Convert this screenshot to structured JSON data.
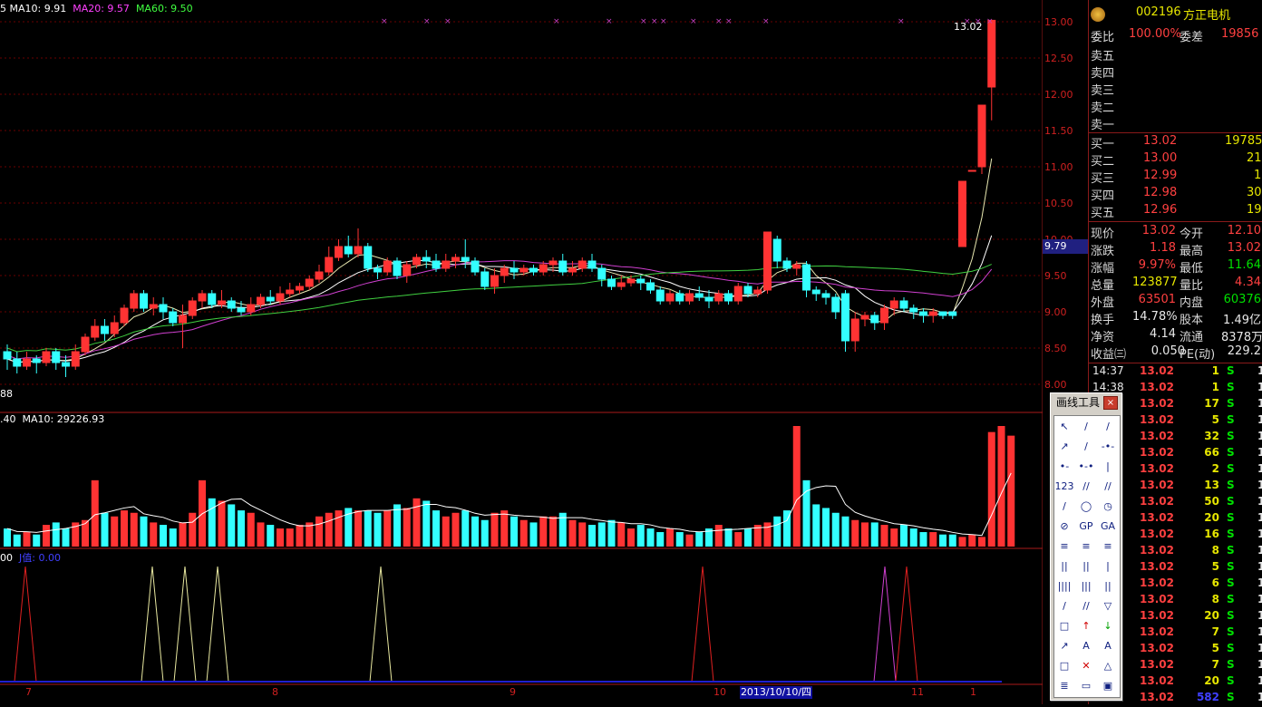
{
  "stock": {
    "code": "002196",
    "name": "方正电机"
  },
  "legend": {
    "ma_line": [
      {
        "label": "MA10: 9.91",
        "color": "#ffffff"
      },
      {
        "label": "MA20: 9.57",
        "color": "#ff40ff"
      },
      {
        "label": "MA60: 9.50",
        "color": "#40ff40"
      }
    ],
    "volume": [
      {
        "label": ".40",
        "color": "#ffffff"
      },
      {
        "label": "MA10: 29226.93",
        "color": "#ffffff"
      }
    ],
    "indicator": [
      {
        "label": "00",
        "color": "#ffffff"
      },
      {
        "label": "J值: 0.00",
        "color": "#4040ff"
      }
    ]
  },
  "price_axis": [
    "13.00",
    "12.50",
    "12.00",
    "11.50",
    "11.00",
    "10.50",
    "10.00",
    "9.50",
    "9.00",
    "8.50",
    "8.00"
  ],
  "price_marker": "9.79",
  "high_label": "13.02",
  "low_label": "88",
  "x_labels": [
    "7",
    "8",
    "9",
    "10",
    "11",
    "1"
  ],
  "date_cursor": "2013/10/10/四",
  "quote": {
    "weibi_label": "委比",
    "weibi": "100.00%",
    "weicha_label": "委差",
    "weicha": "19856",
    "sell": [
      {
        "label": "卖五",
        "price": "",
        "vol": ""
      },
      {
        "label": "卖四",
        "price": "",
        "vol": ""
      },
      {
        "label": "卖三",
        "price": "",
        "vol": ""
      },
      {
        "label": "卖二",
        "price": "",
        "vol": ""
      },
      {
        "label": "卖一",
        "price": "",
        "vol": ""
      }
    ],
    "buy": [
      {
        "label": "买一",
        "price": "13.02",
        "vol": "19785"
      },
      {
        "label": "买二",
        "price": "13.00",
        "vol": "21"
      },
      {
        "label": "买三",
        "price": "12.99",
        "vol": "1"
      },
      {
        "label": "买四",
        "price": "12.98",
        "vol": "30"
      },
      {
        "label": "买五",
        "price": "12.96",
        "vol": "19"
      }
    ],
    "stats": [
      {
        "l1": "现价",
        "v1": "13.02",
        "c1": "red",
        "l2": "今开",
        "v2": "12.10",
        "c2": "red"
      },
      {
        "l1": "涨跌",
        "v1": "1.18",
        "c1": "red",
        "l2": "最高",
        "v2": "13.02",
        "c2": "red"
      },
      {
        "l1": "涨幅",
        "v1": "9.97%",
        "c1": "red",
        "l2": "最低",
        "v2": "11.64",
        "c2": "grn"
      },
      {
        "l1": "总量",
        "v1": "123877",
        "c1": "yel",
        "l2": "量比",
        "v2": "4.34",
        "c2": "red"
      },
      {
        "l1": "外盘",
        "v1": "63501",
        "c1": "red",
        "l2": "内盘",
        "v2": "60376",
        "c2": "grn"
      },
      {
        "l1": "换手",
        "v1": "14.78%",
        "c1": "wht",
        "l2": "股本",
        "v2": "1.49亿",
        "c2": "wht"
      },
      {
        "l1": "净资",
        "v1": "4.14",
        "c1": "wht",
        "l2": "流通",
        "v2": "8378万",
        "c2": "wht"
      },
      {
        "l1": "收益㈢",
        "v1": "0.050",
        "c1": "wht",
        "l2": "PE(动)",
        "v2": "229.2",
        "c2": "wht"
      }
    ],
    "ticks": [
      {
        "time": "14:37",
        "price": "13.02",
        "vol": "1",
        "bs": "S",
        "n": "1"
      },
      {
        "time": "14:38",
        "price": "13.02",
        "vol": "1",
        "bs": "S",
        "n": "1"
      },
      {
        "time": "",
        "price": "13.02",
        "vol": "17",
        "bs": "S",
        "n": "1"
      },
      {
        "time": "",
        "price": "13.02",
        "vol": "5",
        "bs": "S",
        "n": "1"
      },
      {
        "time": "",
        "price": "13.02",
        "vol": "32",
        "bs": "S",
        "n": "1"
      },
      {
        "time": "",
        "price": "13.02",
        "vol": "66",
        "bs": "S",
        "n": "1"
      },
      {
        "time": "",
        "price": "13.02",
        "vol": "2",
        "bs": "S",
        "n": "1"
      },
      {
        "time": "",
        "price": "13.02",
        "vol": "13",
        "bs": "S",
        "n": "1"
      },
      {
        "time": "",
        "price": "13.02",
        "vol": "50",
        "bs": "S",
        "n": "1"
      },
      {
        "time": "",
        "price": "13.02",
        "vol": "20",
        "bs": "S",
        "n": "1"
      },
      {
        "time": "",
        "price": "13.02",
        "vol": "16",
        "bs": "S",
        "n": "1"
      },
      {
        "time": "",
        "price": "13.02",
        "vol": "8",
        "bs": "S",
        "n": "1"
      },
      {
        "time": "",
        "price": "13.02",
        "vol": "5",
        "bs": "S",
        "n": "1"
      },
      {
        "time": "",
        "price": "13.02",
        "vol": "6",
        "bs": "S",
        "n": "1"
      },
      {
        "time": "",
        "price": "13.02",
        "vol": "8",
        "bs": "S",
        "n": "1"
      },
      {
        "time": "",
        "price": "13.02",
        "vol": "20",
        "bs": "S",
        "n": "1"
      },
      {
        "time": "",
        "price": "13.02",
        "vol": "7",
        "bs": "S",
        "n": "1"
      },
      {
        "time": "",
        "price": "13.02",
        "vol": "5",
        "bs": "S",
        "n": "1"
      },
      {
        "time": "",
        "price": "13.02",
        "vol": "7",
        "bs": "S",
        "n": "1"
      },
      {
        "time": "",
        "price": "13.02",
        "vol": "20",
        "bs": "S",
        "n": "1"
      },
      {
        "time": "",
        "price": "13.02",
        "vol": "582",
        "bs": "S",
        "n": "1"
      }
    ]
  },
  "toolbar": {
    "title": "画线工具",
    "close": "×",
    "tools": [
      "↖",
      "/",
      "/",
      "↗",
      "/",
      "-•-",
      "•-",
      "•-•",
      "|",
      "123",
      "//",
      "//",
      "/",
      "◯",
      "◷",
      "⊘",
      "GP",
      "GA",
      "≡",
      "≡",
      "≡",
      "||",
      "||",
      "|",
      "||||",
      "|||",
      "||",
      "/",
      "//",
      "▽",
      "□",
      "↑",
      "↓",
      "↗",
      "A",
      "A",
      "□",
      "✕",
      "△",
      "≣",
      "▭",
      "▣"
    ]
  },
  "chart_data": {
    "type": "line",
    "candles": [
      {
        "o": 8.45,
        "c": 8.35,
        "h": 8.55,
        "l": 8.2
      },
      {
        "o": 8.35,
        "c": 8.25,
        "h": 8.45,
        "l": 8.15
      },
      {
        "o": 8.25,
        "c": 8.35,
        "h": 8.45,
        "l": 8.2
      },
      {
        "o": 8.35,
        "c": 8.3,
        "h": 8.4,
        "l": 8.15
      },
      {
        "o": 8.3,
        "c": 8.45,
        "h": 8.5,
        "l": 8.25
      },
      {
        "o": 8.45,
        "c": 8.3,
        "h": 8.5,
        "l": 8.2
      },
      {
        "o": 8.3,
        "c": 8.25,
        "h": 8.4,
        "l": 8.1
      },
      {
        "o": 8.25,
        "c": 8.45,
        "h": 8.55,
        "l": 8.2
      },
      {
        "o": 8.45,
        "c": 8.65,
        "h": 8.7,
        "l": 8.4
      },
      {
        "o": 8.65,
        "c": 8.8,
        "h": 8.9,
        "l": 8.6
      },
      {
        "o": 8.8,
        "c": 8.7,
        "h": 8.9,
        "l": 8.6
      },
      {
        "o": 8.7,
        "c": 8.85,
        "h": 8.95,
        "l": 8.65
      },
      {
        "o": 8.85,
        "c": 9.05,
        "h": 9.1,
        "l": 8.8
      },
      {
        "o": 9.05,
        "c": 9.25,
        "h": 9.3,
        "l": 9.0
      },
      {
        "o": 9.25,
        "c": 9.05,
        "h": 9.3,
        "l": 9.0
      },
      {
        "o": 9.05,
        "c": 9.1,
        "h": 9.2,
        "l": 8.95
      },
      {
        "o": 9.1,
        "c": 9.0,
        "h": 9.2,
        "l": 8.9
      },
      {
        "o": 9.0,
        "c": 8.85,
        "h": 9.05,
        "l": 8.8
      },
      {
        "o": 8.85,
        "c": 8.95,
        "h": 9.1,
        "l": 8.5
      },
      {
        "o": 8.95,
        "c": 9.15,
        "h": 9.2,
        "l": 8.9
      },
      {
        "o": 9.15,
        "c": 9.25,
        "h": 9.3,
        "l": 9.05
      },
      {
        "o": 9.25,
        "c": 9.1,
        "h": 9.3,
        "l": 9.05
      },
      {
        "o": 9.1,
        "c": 9.15,
        "h": 9.3,
        "l": 9.05
      },
      {
        "o": 9.15,
        "c": 9.05,
        "h": 9.2,
        "l": 9.0
      },
      {
        "o": 9.05,
        "c": 9.0,
        "h": 9.15,
        "l": 8.95
      },
      {
        "o": 9.0,
        "c": 9.1,
        "h": 9.2,
        "l": 8.95
      },
      {
        "o": 9.1,
        "c": 9.2,
        "h": 9.25,
        "l": 9.05
      },
      {
        "o": 9.2,
        "c": 9.15,
        "h": 9.3,
        "l": 9.1
      },
      {
        "o": 9.15,
        "c": 9.25,
        "h": 9.35,
        "l": 9.1
      },
      {
        "o": 9.25,
        "c": 9.3,
        "h": 9.4,
        "l": 9.2
      },
      {
        "o": 9.3,
        "c": 9.35,
        "h": 9.4,
        "l": 9.25
      },
      {
        "o": 9.35,
        "c": 9.45,
        "h": 9.5,
        "l": 9.3
      },
      {
        "o": 9.45,
        "c": 9.55,
        "h": 9.65,
        "l": 9.4
      },
      {
        "o": 9.55,
        "c": 9.75,
        "h": 9.9,
        "l": 9.5
      },
      {
        "o": 9.75,
        "c": 9.9,
        "h": 10.0,
        "l": 9.7
      },
      {
        "o": 9.9,
        "c": 9.8,
        "h": 10.05,
        "l": 9.75
      },
      {
        "o": 9.8,
        "c": 9.9,
        "h": 10.15,
        "l": 9.75
      },
      {
        "o": 9.9,
        "c": 9.6,
        "h": 9.95,
        "l": 9.55
      },
      {
        "o": 9.6,
        "c": 9.55,
        "h": 9.65,
        "l": 9.45
      },
      {
        "o": 9.55,
        "c": 9.7,
        "h": 9.75,
        "l": 9.5
      },
      {
        "o": 9.7,
        "c": 9.5,
        "h": 9.75,
        "l": 9.45
      },
      {
        "o": 9.5,
        "c": 9.65,
        "h": 9.7,
        "l": 9.4
      },
      {
        "o": 9.65,
        "c": 9.75,
        "h": 9.8,
        "l": 9.6
      },
      {
        "o": 9.75,
        "c": 9.7,
        "h": 9.85,
        "l": 9.6
      },
      {
        "o": 9.7,
        "c": 9.6,
        "h": 9.8,
        "l": 9.55
      },
      {
        "o": 9.6,
        "c": 9.7,
        "h": 9.8,
        "l": 9.55
      },
      {
        "o": 9.7,
        "c": 9.75,
        "h": 9.8,
        "l": 9.6
      },
      {
        "o": 9.75,
        "c": 9.7,
        "h": 10.0,
        "l": 9.6
      },
      {
        "o": 9.7,
        "c": 9.55,
        "h": 9.75,
        "l": 9.5
      },
      {
        "o": 9.55,
        "c": 9.35,
        "h": 9.6,
        "l": 9.3
      },
      {
        "o": 9.35,
        "c": 9.5,
        "h": 9.6,
        "l": 9.25
      },
      {
        "o": 9.5,
        "c": 9.6,
        "h": 9.65,
        "l": 9.4
      },
      {
        "o": 9.6,
        "c": 9.55,
        "h": 9.7,
        "l": 9.45
      },
      {
        "o": 9.55,
        "c": 9.6,
        "h": 9.65,
        "l": 9.5
      },
      {
        "o": 9.6,
        "c": 9.55,
        "h": 9.65,
        "l": 9.5
      },
      {
        "o": 9.55,
        "c": 9.65,
        "h": 9.7,
        "l": 9.5
      },
      {
        "o": 9.65,
        "c": 9.7,
        "h": 9.75,
        "l": 9.55
      },
      {
        "o": 9.7,
        "c": 9.55,
        "h": 9.8,
        "l": 9.5
      },
      {
        "o": 9.55,
        "c": 9.6,
        "h": 9.7,
        "l": 9.5
      },
      {
        "o": 9.6,
        "c": 9.7,
        "h": 9.75,
        "l": 9.55
      },
      {
        "o": 9.7,
        "c": 9.6,
        "h": 9.8,
        "l": 9.55
      },
      {
        "o": 9.6,
        "c": 9.45,
        "h": 9.65,
        "l": 9.35
      },
      {
        "o": 9.45,
        "c": 9.35,
        "h": 9.5,
        "l": 9.3
      },
      {
        "o": 9.35,
        "c": 9.4,
        "h": 9.5,
        "l": 9.3
      },
      {
        "o": 9.4,
        "c": 9.45,
        "h": 9.5,
        "l": 9.35
      },
      {
        "o": 9.45,
        "c": 9.4,
        "h": 9.5,
        "l": 9.3
      },
      {
        "o": 9.4,
        "c": 9.3,
        "h": 9.45,
        "l": 9.25
      },
      {
        "o": 9.3,
        "c": 9.15,
        "h": 9.35,
        "l": 9.1
      },
      {
        "o": 9.15,
        "c": 9.25,
        "h": 9.3,
        "l": 9.1
      },
      {
        "o": 9.25,
        "c": 9.15,
        "h": 9.3,
        "l": 9.1
      },
      {
        "o": 9.15,
        "c": 9.25,
        "h": 9.3,
        "l": 9.1
      },
      {
        "o": 9.25,
        "c": 9.2,
        "h": 9.35,
        "l": 9.15
      },
      {
        "o": 9.2,
        "c": 9.15,
        "h": 9.3,
        "l": 9.05
      },
      {
        "o": 9.15,
        "c": 9.25,
        "h": 9.3,
        "l": 9.1
      },
      {
        "o": 9.25,
        "c": 9.15,
        "h": 9.3,
        "l": 9.1
      },
      {
        "o": 9.15,
        "c": 9.35,
        "h": 9.4,
        "l": 9.1
      },
      {
        "o": 9.35,
        "c": 9.25,
        "h": 9.4,
        "l": 9.2
      },
      {
        "o": 9.25,
        "c": 9.3,
        "h": 9.35,
        "l": 9.2
      },
      {
        "o": 9.3,
        "c": 10.1,
        "h": 10.1,
        "l": 9.25
      },
      {
        "o": 10.0,
        "c": 9.7,
        "h": 10.05,
        "l": 9.6
      },
      {
        "o": 9.7,
        "c": 9.6,
        "h": 9.75,
        "l": 9.55
      },
      {
        "o": 9.6,
        "c": 9.65,
        "h": 9.7,
        "l": 9.5
      },
      {
        "o": 9.65,
        "c": 9.3,
        "h": 9.7,
        "l": 9.2
      },
      {
        "o": 9.3,
        "c": 9.25,
        "h": 9.35,
        "l": 9.15
      },
      {
        "o": 9.25,
        "c": 9.2,
        "h": 9.3,
        "l": 9.1
      },
      {
        "o": 9.2,
        "c": 9.0,
        "h": 9.25,
        "l": 8.9
      },
      {
        "o": 9.25,
        "c": 8.6,
        "h": 9.3,
        "l": 8.45
      },
      {
        "o": 8.6,
        "c": 8.9,
        "h": 9.0,
        "l": 8.45
      },
      {
        "o": 8.9,
        "c": 8.95,
        "h": 9.0,
        "l": 8.8
      },
      {
        "o": 8.95,
        "c": 8.85,
        "h": 9.0,
        "l": 8.75
      },
      {
        "o": 8.85,
        "c": 9.05,
        "h": 9.1,
        "l": 8.75
      },
      {
        "o": 9.05,
        "c": 9.15,
        "h": 9.2,
        "l": 8.95
      },
      {
        "o": 9.15,
        "c": 9.05,
        "h": 9.2,
        "l": 9.0
      },
      {
        "o": 9.05,
        "c": 9.0,
        "h": 9.1,
        "l": 8.9
      },
      {
        "o": 9.0,
        "c": 8.95,
        "h": 9.05,
        "l": 8.85
      },
      {
        "o": 8.95,
        "c": 9.0,
        "h": 9.05,
        "l": 8.85
      },
      {
        "o": 9.0,
        "c": 8.95,
        "h": 9.0,
        "l": 8.9
      },
      {
        "o": 9.0,
        "c": 8.95,
        "h": 9.0,
        "l": 8.9
      },
      {
        "o": 9.9,
        "c": 10.8,
        "h": 10.8,
        "l": 9.9
      },
      {
        "o": 10.95,
        "c": 10.95,
        "h": 10.95,
        "l": 10.95
      },
      {
        "o": 11.0,
        "c": 11.85,
        "h": 11.85,
        "l": 10.9
      },
      {
        "o": 12.1,
        "c": 13.02,
        "h": 13.02,
        "l": 11.64
      }
    ],
    "volumes": [
      0.15,
      0.1,
      0.12,
      0.1,
      0.18,
      0.2,
      0.15,
      0.2,
      0.22,
      0.55,
      0.28,
      0.25,
      0.3,
      0.28,
      0.25,
      0.2,
      0.18,
      0.15,
      0.2,
      0.28,
      0.55,
      0.4,
      0.38,
      0.35,
      0.3,
      0.28,
      0.2,
      0.18,
      0.15,
      0.15,
      0.18,
      0.2,
      0.25,
      0.28,
      0.3,
      0.32,
      0.3,
      0.3,
      0.28,
      0.3,
      0.35,
      0.32,
      0.4,
      0.38,
      0.3,
      0.25,
      0.28,
      0.3,
      0.25,
      0.22,
      0.28,
      0.3,
      0.25,
      0.22,
      0.2,
      0.25,
      0.25,
      0.28,
      0.22,
      0.2,
      0.18,
      0.2,
      0.22,
      0.2,
      0.15,
      0.18,
      0.15,
      0.12,
      0.15,
      0.12,
      0.1,
      0.12,
      0.15,
      0.18,
      0.15,
      0.12,
      0.15,
      0.18,
      0.2,
      0.25,
      0.3,
      1.0,
      0.55,
      0.35,
      0.32,
      0.28,
      0.25,
      0.22,
      0.2,
      0.2,
      0.18,
      0.15,
      0.18,
      0.15,
      0.12,
      0.12,
      0.1,
      0.1,
      0.08,
      0.1,
      0.08,
      0.95,
      1.0,
      0.92
    ],
    "ylim": [
      8.0,
      13.0
    ]
  }
}
